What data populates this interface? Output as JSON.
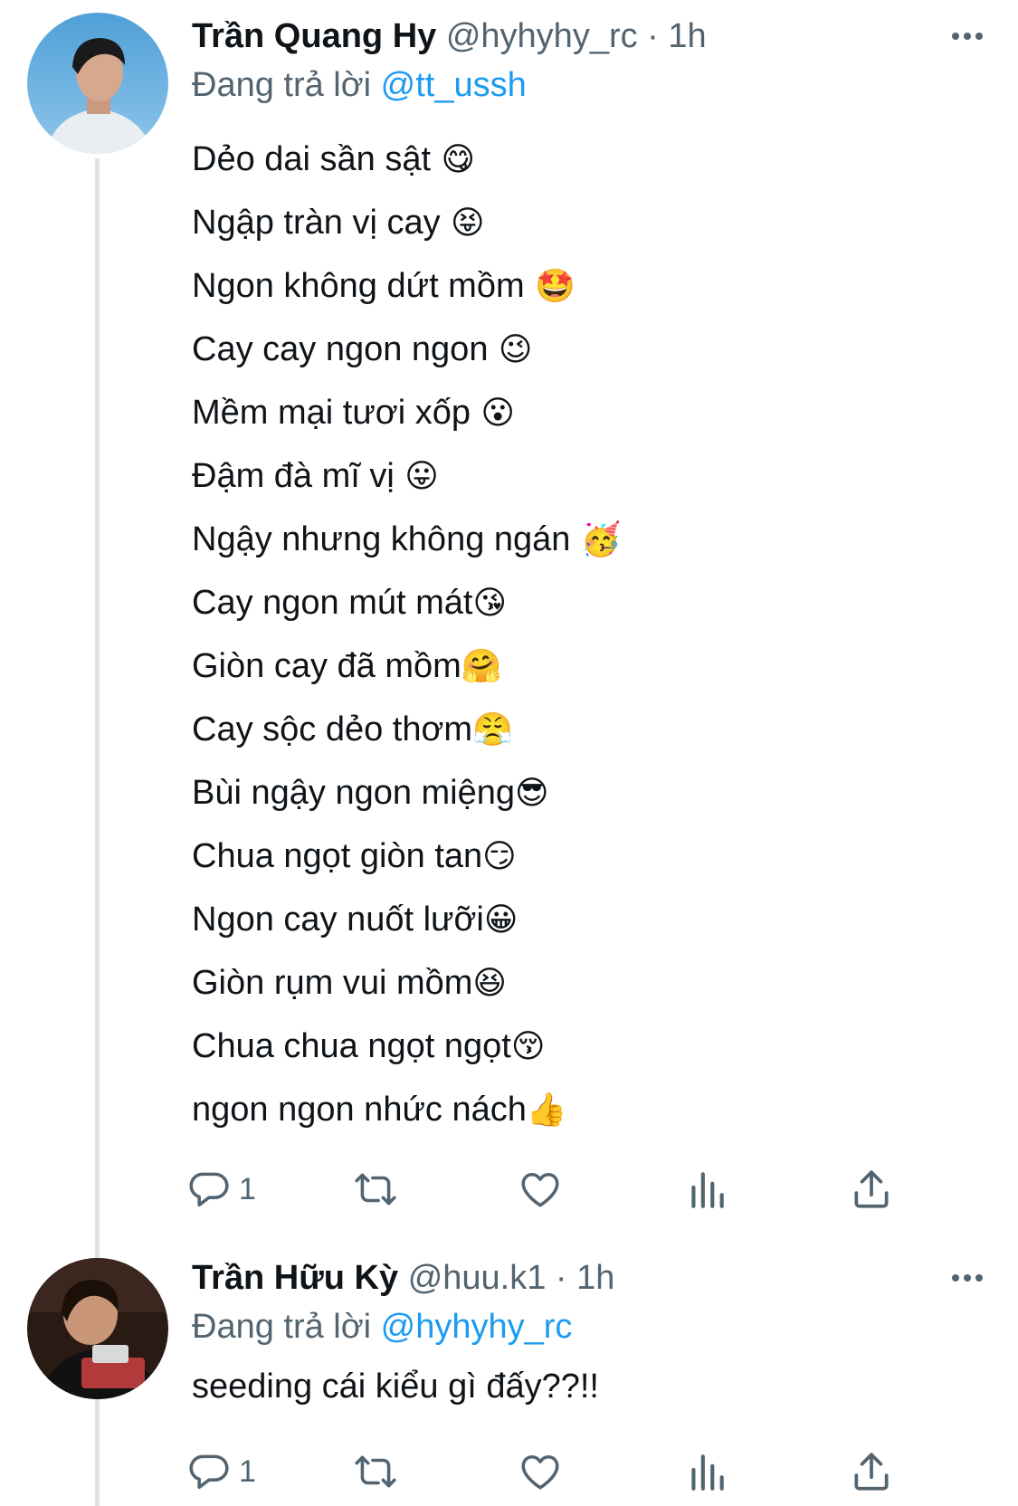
{
  "tweets": [
    {
      "display_name": "Trần Quang Hy",
      "handle": "@hyhyhy_rc",
      "separator": "·",
      "time": "1h",
      "replying_label": "Đang trả lời",
      "replying_to": "@tt_ussh",
      "lines": [
        {
          "text": "Dẻo dai sần sật",
          "emoji": " 😋"
        },
        {
          "text": "Ngập tràn vị cay",
          "emoji": " 😝"
        },
        {
          "text": "Ngon không dứt mồm",
          "emoji": " 🤩"
        },
        {
          "text": "Cay cay ngon ngon",
          "emoji": " 😉"
        },
        {
          "text": "Mềm mại tươi xốp",
          "emoji": " 😮"
        },
        {
          "text": "Đậm đà mĩ vị",
          "emoji": " 😛"
        },
        {
          "text": "Ngậy nhưng không ngán",
          "emoji": " 🥳"
        },
        {
          "text": "Cay ngon mút mát",
          "emoji": "😘"
        },
        {
          "text": "Giòn cay đã mồm",
          "emoji": "🤗"
        },
        {
          "text": "Cay sộc dẻo thơm",
          "emoji": "😤"
        },
        {
          "text": "Bùi ngậy ngon miệng",
          "emoji": "😎"
        },
        {
          "text": "Chua ngọt giòn tan",
          "emoji": "😏"
        },
        {
          "text": "Ngon cay nuốt lưỡi",
          "emoji": "😀"
        },
        {
          "text": "Giòn rụm vui mồm",
          "emoji": "😆"
        },
        {
          "text": "Chua chua ngọt ngọt",
          "emoji": "😚"
        },
        {
          "text": "ngon ngon nhức nách",
          "emoji": "👍"
        }
      ],
      "reply_count": "1"
    },
    {
      "display_name": "Trần Hữu Kỳ",
      "handle": "@huu.k1",
      "separator": "·",
      "time": "1h",
      "replying_label": "Đang trả lời",
      "replying_to": "@hyhyhy_rc",
      "text": "seeding cái kiểu gì đấy??!!",
      "reply_count": "1"
    }
  ],
  "icons": [
    "more-icon",
    "reply-icon",
    "retweet-icon",
    "like-icon",
    "views-icon",
    "share-icon"
  ],
  "colors": {
    "text": "#0f1419",
    "secondary": "#536471",
    "link": "#1d9bf0",
    "thread_line": "#dfe3e7"
  }
}
